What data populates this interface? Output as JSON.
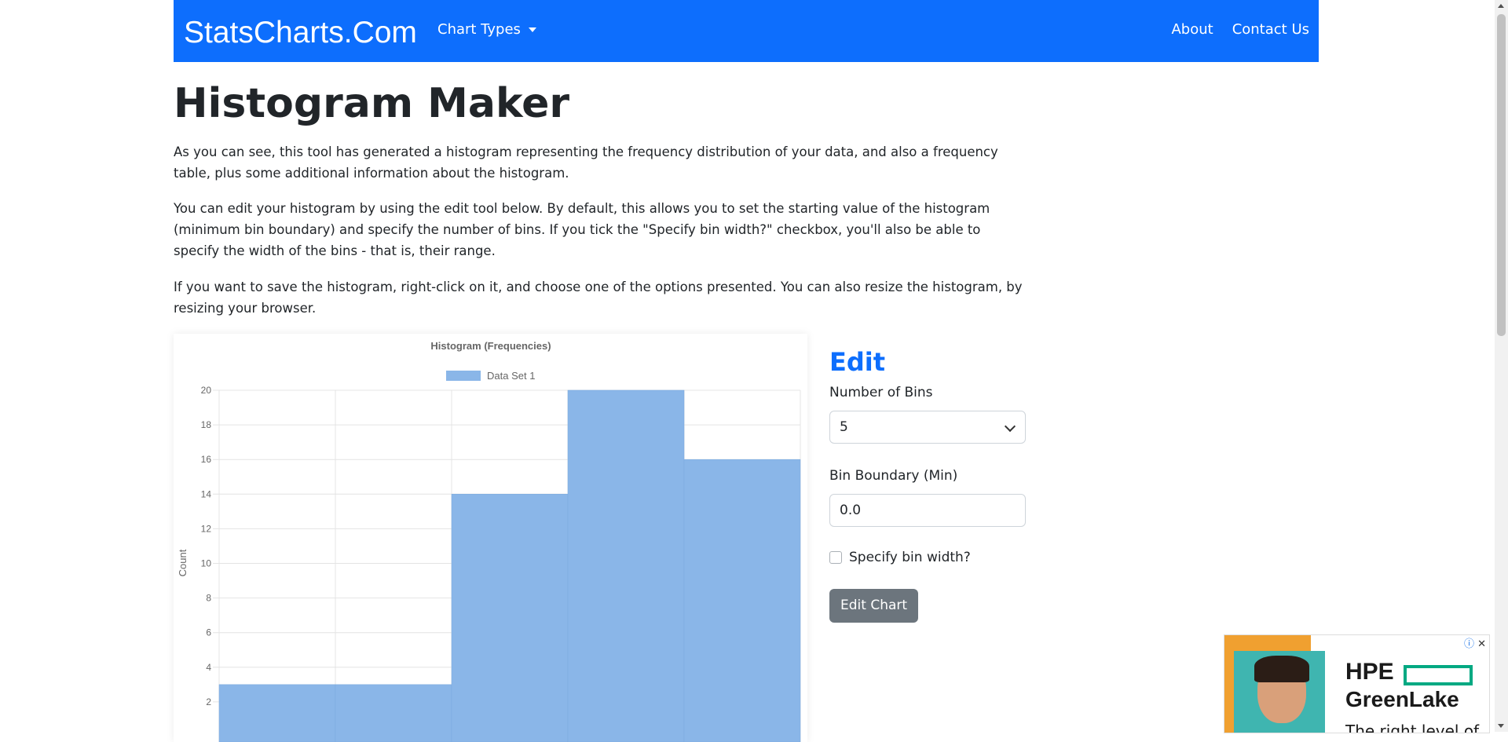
{
  "navbar": {
    "brand": "StatsCharts.Com",
    "chart_types": "Chart Types",
    "about": "About",
    "contact": "Contact Us"
  },
  "page": {
    "title": "Histogram Maker",
    "para1": "As you can see, this tool has generated a histogram representing the frequency distribution of your data, and also a frequency table, plus some additional information about the histogram.",
    "para2": "You can edit your histogram by using the edit tool below. By default, this allows you to set the starting value of the histogram (minimum bin boundary) and specify the number of bins. If you tick the \"Specify bin width?\" checkbox, you'll also be able to specify the width of the bins - that is, their range.",
    "para3": "If you want to save the histogram, right-click on it, and choose one of the options presented. You can also resize the histogram, by resizing your browser."
  },
  "edit": {
    "title": "Edit",
    "bins_label": "Number of Bins",
    "bins_value": "5",
    "boundary_label": "Bin Boundary (Min)",
    "boundary_value": "0.0",
    "binwidth_label": "Specify bin width?",
    "button": "Edit Chart"
  },
  "ad": {
    "brand_line1": "HPE",
    "brand_line2": "GreenLake",
    "tagline": "The right level of",
    "info_icon": "info-icon",
    "close_icon": "close-icon"
  },
  "colors": {
    "navbar": "#0d6efd",
    "bar_fill": "#8ab6e8",
    "button": "#6c757d"
  },
  "chart_data": {
    "type": "bar",
    "title": "Histogram (Frequencies)",
    "legend": "Data Set 1",
    "legend_position": "top",
    "ylabel": "Count",
    "xlabel": "",
    "ylim": [
      0,
      20
    ],
    "yticks": [
      "20",
      "18",
      "16",
      "14",
      "12",
      "10",
      "8",
      "6",
      "4",
      "2"
    ],
    "grid": true,
    "series": [
      {
        "name": "Data Set 1",
        "values": [
          3,
          3,
          14,
          20,
          16
        ]
      }
    ]
  }
}
